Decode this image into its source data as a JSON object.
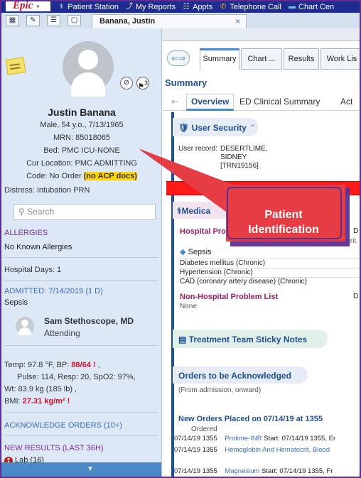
{
  "topbar": {
    "logo": "Epic",
    "items": [
      {
        "label": "Patient Station",
        "icon": "patient-station-icon"
      },
      {
        "label": "My Reports",
        "icon": "reports-icon"
      },
      {
        "label": "Appts",
        "icon": "appointments-icon"
      },
      {
        "label": "Telephone Call",
        "icon": "telephone-icon"
      },
      {
        "label": "Chart Cen",
        "icon": "folder-icon"
      }
    ]
  },
  "patient_tab": {
    "label": "Banana, Justin",
    "close": "×"
  },
  "patient": {
    "name": "Justin Banana",
    "demo": "Male, 54 y.o., 7/13/1965",
    "mrn": "MRN: 85018065",
    "bed": "Bed: PMC ICU-NONE",
    "location": "Cur Location: PMC ADMITTING",
    "code_prefix": "Code: No Order ",
    "code_flag": "(no ACP docs)",
    "distress": "Distress: Intubation PRN",
    "badge_count": "3"
  },
  "sidebar": {
    "search_placeholder": "Search",
    "allergies_header": "ALLERGIES",
    "allergies_value": "No Known Allergies",
    "hospital_days": "Hospital Days: 1",
    "admitted_header": "ADMITTED: 7/14/2019 (1 D)",
    "admitted_reason": "Sepsis",
    "attending_name": "Sam Stethoscope, MD",
    "attending_role": "Attending",
    "vitals": {
      "line1_a": "Temp: 97.8 °F,  BP: ",
      "line1_bp": "88/64",
      "line1_flag": "!",
      "line1_b": " ,",
      "line2": "Pulse: 114,  Resp: 20,  SpO2: 97%,",
      "line3": "Wt: 83.9 kg (185 lb) ,",
      "line4_a": "BMI: ",
      "line4_val": "27.31 kg/m²",
      "line4_flag": "!"
    },
    "ack_orders": "ACKNOWLEDGE ORDERS (10+)",
    "new_results": "NEW RESULTS (LAST 36H)",
    "lab": "Lab (16)"
  },
  "main": {
    "tabs": [
      "Summary",
      "Chart ...",
      "Results",
      "Work Lis"
    ],
    "title": "Summary",
    "subtabs": [
      "Overview",
      "ED Clinical Summary",
      "Act"
    ],
    "user_security": {
      "title": "User Security",
      "label": "User record:",
      "value_lines": [
        "DESERTLIME,",
        "SIDNEY",
        "[TRN19156]"
      ]
    },
    "medical": {
      "title": "Medica",
      "hospital_problems": "Hospital Pro",
      "d_col": "D",
      "priority": "Priorit",
      "problems": [
        "Sepsis",
        "Diabetes mellitus (Chronic)",
        "Hypertension (Chronic)",
        "CAD (coronary artery disease) (Chronic)"
      ],
      "non_hospital": "Non-Hospital Problem List",
      "none": "None"
    },
    "sticky_notes": "Treatment Team Sticky Notes",
    "orders": {
      "title": "Orders to be Acknowledged",
      "subtitle": "(From admission, onward)",
      "placed": "New Orders Placed on 07/14/19 at 1355",
      "col_ordered": "Ordered",
      "rows": [
        {
          "time": "07/14/19 1355",
          "text": "Protime-INR",
          "detail": " Start: 07/14/19 1355, Er"
        },
        {
          "time": "07/14/19 1355",
          "text": "Hemoglobin And Hematocrit, Blood",
          "detail": ""
        },
        {
          "time": "07/14/19 1355",
          "text": "Magnesium",
          "detail": " Start: 07/14/19 1355, Fr"
        }
      ]
    }
  },
  "callout": {
    "line1": "Patient",
    "line2": "Identification",
    "color": "#e63c44"
  }
}
